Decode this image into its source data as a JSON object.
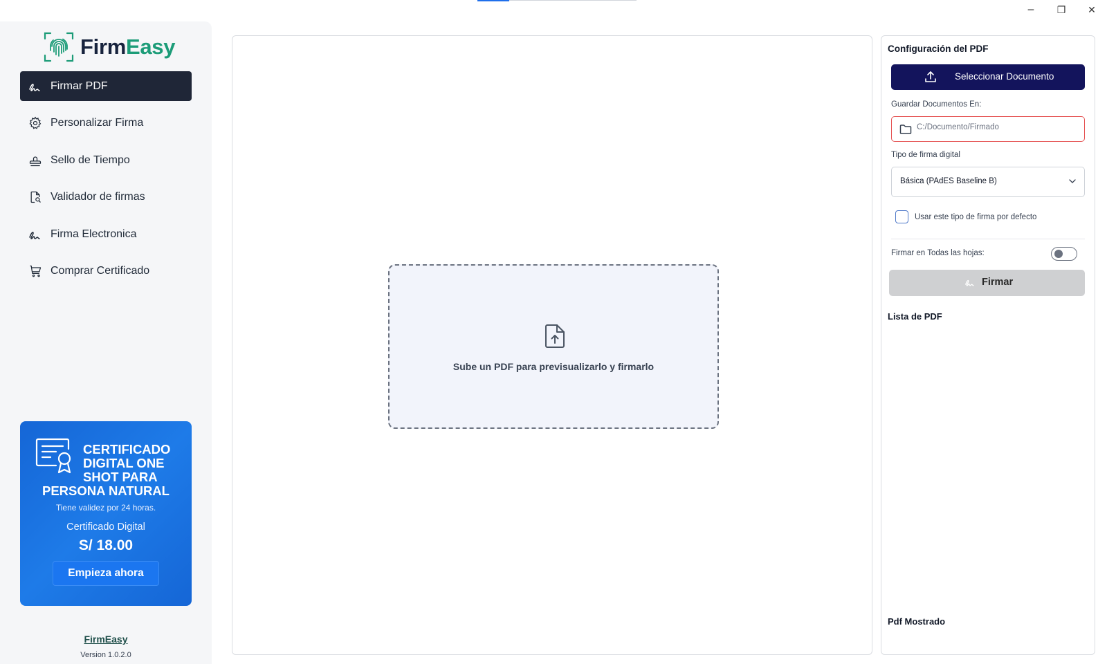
{
  "window": {
    "controls": {
      "minimize": "─",
      "restore": "❐",
      "close": "✕"
    }
  },
  "sidebar": {
    "logo": {
      "firm": "Firm",
      "easy": "Easy"
    },
    "items": [
      {
        "label": "Firmar PDF",
        "icon": "signature-icon",
        "active": true
      },
      {
        "label": "Personalizar Firma",
        "icon": "gear-icon",
        "active": false
      },
      {
        "label": "Sello de Tiempo",
        "icon": "stamp-icon",
        "active": false
      },
      {
        "label": "Validador de firmas",
        "icon": "document-search-icon",
        "active": false
      },
      {
        "label": "Firma Electronica",
        "icon": "signature-icon",
        "active": false
      },
      {
        "label": "Comprar Certificado",
        "icon": "cart-icon",
        "active": false
      }
    ],
    "promo": {
      "title_top": "Certificado Digital One Shot para",
      "title_bottom": "Persona Natural",
      "subtitle": "Tiene validez por 24 horas.",
      "product": "Certificado Digital",
      "price": "S/ 18.00",
      "cta": "Empieza ahora"
    },
    "footer": {
      "brand": "FirmEasy",
      "version": "Version 1.0.2.0"
    }
  },
  "preview": {
    "dropzone_text": "Sube un PDF para previsualizarlo y firmarlo"
  },
  "config": {
    "title": "Configuración del PDF",
    "select_button": "Seleccionar Documento",
    "save_label": "Guardar Documentos En:",
    "save_placeholder": "C:/Documento/Firmado",
    "signature_type_label": "Tipo de firma digital",
    "signature_type_value": "Básica (PAdES Baseline B)",
    "default_checkbox_label": "Usar este tipo de firma por defecto",
    "all_pages_label": "Firmar en Todas las hojas:",
    "all_pages_enabled": false,
    "sign_button": "Firmar",
    "pdf_list_title": "Lista de PDF",
    "pdf_shown_title": "Pdf Mostrado"
  },
  "colors": {
    "active_nav": "#1f2637",
    "primary_button": "#13145c",
    "promo_blue": "#1566d6",
    "brand_green": "#1c9c78",
    "error_border": "#e55353"
  }
}
